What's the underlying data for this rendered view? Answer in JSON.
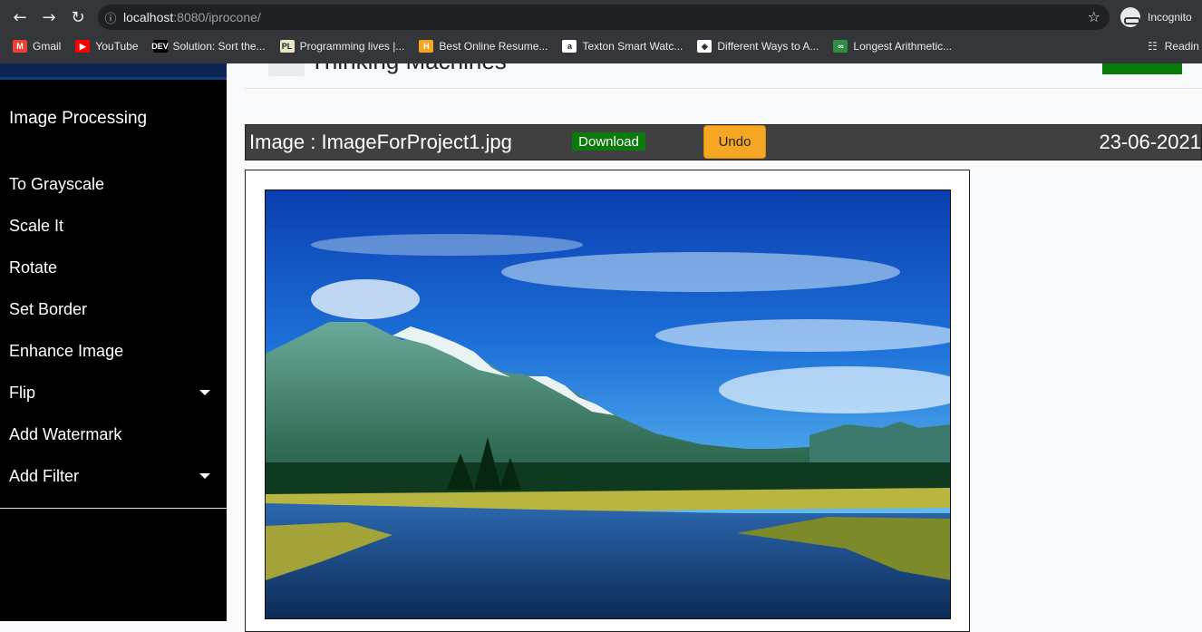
{
  "browser": {
    "url_host": "localhost",
    "url_rest": ":8080/iprocone/",
    "incognito_label": "Incognito",
    "bookmarks": [
      {
        "label": "Gmail",
        "icon": "gmail-icon",
        "color": "#ea4335",
        "glyph": "M"
      },
      {
        "label": "YouTube",
        "icon": "youtube-icon",
        "color": "#ff0000",
        "glyph": "▶"
      },
      {
        "label": "Solution: Sort the...",
        "icon": "dev-icon",
        "color": "#000000",
        "glyph": "DEV"
      },
      {
        "label": "Programming lives |...",
        "icon": "programming-lives-icon",
        "color": "#e8e4c8",
        "glyph": "PL"
      },
      {
        "label": "Best Online Resume...",
        "icon": "resume-icon",
        "color": "#f5a623",
        "glyph": "H"
      },
      {
        "label": "Texton Smart Watc...",
        "icon": "amazon-icon",
        "color": "#ffffff",
        "glyph": "a"
      },
      {
        "label": "Different Ways to A...",
        "icon": "diamond-icon",
        "color": "#ffffff",
        "glyph": "◈"
      },
      {
        "label": "Longest Arithmetic...",
        "icon": "geeks-icon",
        "color": "#2f8d46",
        "glyph": "∞"
      }
    ],
    "reading_label": "Readin"
  },
  "sidebar": {
    "title": "Image Processing",
    "items": [
      {
        "label": "To Grayscale",
        "dropdown": false
      },
      {
        "label": "Scale It",
        "dropdown": false
      },
      {
        "label": "Rotate",
        "dropdown": false
      },
      {
        "label": "Set Border",
        "dropdown": false
      },
      {
        "label": "Enhance Image",
        "dropdown": false
      },
      {
        "label": "Flip",
        "dropdown": true
      },
      {
        "label": "Add Watermark",
        "dropdown": false
      },
      {
        "label": "Add Filter",
        "dropdown": true
      }
    ]
  },
  "header": {
    "title": "Thinking Machines"
  },
  "image_bar": {
    "name": "Image : ImageForProject1.jpg",
    "download_label": "Download",
    "undo_label": "Undo",
    "date": "23-06-2021"
  },
  "colors": {
    "sidebar_bg": "#000000",
    "download_green": "#0a7a0a",
    "undo_orange": "#f5a623",
    "image_bar_bg": "#404040"
  }
}
